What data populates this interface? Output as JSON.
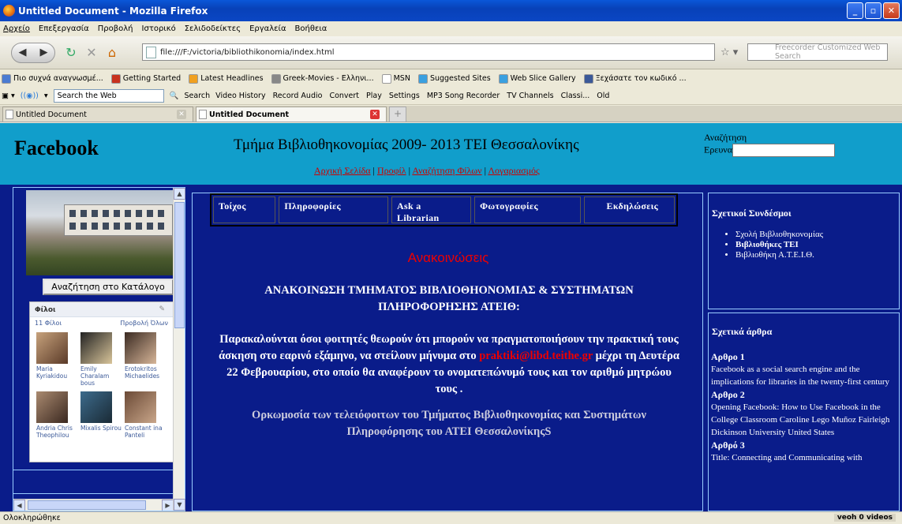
{
  "window": {
    "title": "Untitled Document - Mozilla Firefox"
  },
  "menu": [
    "Αρχείο",
    "Επεξεργασία",
    "Προβολή",
    "Ιστορικό",
    "Σελιδοδείκτες",
    "Εργαλεία",
    "Βοήθεια"
  ],
  "nav": {
    "url": "file:///F:/victoria/bibliothikonomia/index.html",
    "search_placeholder": "Freecorder Customized Web Search"
  },
  "bookmarks": [
    {
      "label": "Πιο συχνά αναγνωσμέ...",
      "color": "#4a7bd2"
    },
    {
      "label": "Getting Started",
      "color": "#c8321e"
    },
    {
      "label": "Latest Headlines",
      "color": "#f0a020"
    },
    {
      "label": "Greek-Movies - Ελληνι...",
      "color": "#888888"
    },
    {
      "label": "MSN",
      "color": "#ffffff"
    },
    {
      "label": "Suggested Sites",
      "color": "#3aa0e0"
    },
    {
      "label": "Web Slice Gallery",
      "color": "#3aa0e0"
    },
    {
      "label": "Ξεχάσατε τον κωδικό ...",
      "color": "#3b5998"
    }
  ],
  "toolbar2": {
    "search_web": "Search the Web",
    "search_label": "Search",
    "items": [
      "Video History",
      "Record Audio",
      "Convert",
      "Play",
      "Settings",
      "MP3 Song Recorder",
      "TV Channels",
      "Classi...",
      "Old"
    ]
  },
  "tabs": [
    {
      "label": "Untitled Document",
      "active": false
    },
    {
      "label": "Untitled Document",
      "active": true
    }
  ],
  "header": {
    "logo": "Facebook",
    "site_title": "Τμήμα Βιβλιοθηκονομίας 2009- 2013 ΤΕΙ Θεσσαλονίκης",
    "nav": [
      "Αρχική Σελίδα",
      "Προφίλ",
      "Αναζήτηση Φίλων",
      "Λογαριασμός"
    ],
    "search_title": "Αναζήτηση",
    "search_label": "Ερευνα"
  },
  "left": {
    "catalog_button": "Αναζήτηση στο Κατάλογο",
    "friends_title": "Φίλοι",
    "friends_count": "11 Φίλοι",
    "friends_view_all": "Προβολή Όλων",
    "friends": [
      {
        "name": "Maria Kyriakidou",
        "c1": "#c7a27c",
        "c2": "#5a3a28"
      },
      {
        "name": "Emily Charalam bous",
        "c1": "#222222",
        "c2": "#d8c49a"
      },
      {
        "name": "Erotokritos Michaelides",
        "c1": "#3a2a22",
        "c2": "#d6b598"
      },
      {
        "name": "Andria Chris Theophilou",
        "c1": "#aa8a70",
        "c2": "#3a2820"
      },
      {
        "name": "Mixalis Spirou",
        "c1": "#3d6b8c",
        "c2": "#1a2a35"
      },
      {
        "name": "Constant ina Panteli",
        "c1": "#6b4a36",
        "c2": "#c9a68a"
      }
    ]
  },
  "main": {
    "tabs": [
      "Τοίχος",
      "Πληροφορίες",
      "Ask a Librarian",
      "Φωτογραφίες",
      "Εκδηλώσεις"
    ],
    "ann_title": "Ανακοινώσεις",
    "ann_heading": "ΑΝΑΚΟΙΝΩΣΗ ΤΜΗΜΑΤΟΣ ΒΙΒΛΙΟΘΗΟΝΟΜΙΑΣ & ΣΥΣΤΗΜΑΤΩΝ ΠΛΗΡΟΦΟΡΗΣΗΣ ΑΤΕΙΘ:",
    "ann_p1": "Παρακαλούνται όσοι φοιτητές θεωρούν ότι μπορούν να πραγματοποιήσουν την πρακτική τους άσκηση στο εαρινό εξάμηνο, να στείλουν μήνυμα στο",
    "ann_email": "praktiki@libd.teithe.gr",
    "ann_p2": "μέχρι τη Δευτέρα 22 Φεβρουαρίου, στο οποίο θα αναφέρουν το ονοματεπώνυμό τους και τον αριθμό μητρώου τους .",
    "ann_link": "Ορκωμοσία των τελειόφοιτων του Τμήματος Βιβλιοθηκονομίας και Συστημάτων Πληροφόρησης του ΑΤΕΙ ΘεσσαλονίκηςS"
  },
  "right": {
    "links_title": "Σχετικοί Συνδέσμοι",
    "links": [
      {
        "label": "Σχολή Βιβλιοθηκονομίας",
        "bold": false
      },
      {
        "label": "Βιβλιοθήκες ΤΕΙ",
        "bold": true
      },
      {
        "label": "Βιβλιοθήκη Α.Τ.Ε.Ι.Θ.",
        "bold": false
      }
    ],
    "articles_title": "Σχετικά άρθρα",
    "articles": [
      {
        "head": "Αρθρο 1",
        "text": "Facebook as a social search engine and the implications for libraries in the twenty-first century"
      },
      {
        "head": "Αρθρο 2",
        "text": "Opening Facebook: How to Use Facebook in the College Classroom Caroline Lego Muñoz Fairleigh Dickinson University United States"
      },
      {
        "head": "Αρθρό 3",
        "text": "Title: Connecting and Communicating with"
      }
    ]
  },
  "status": {
    "text": "Ολοκληρώθηκε",
    "veoh": "veoh  0 videos"
  }
}
